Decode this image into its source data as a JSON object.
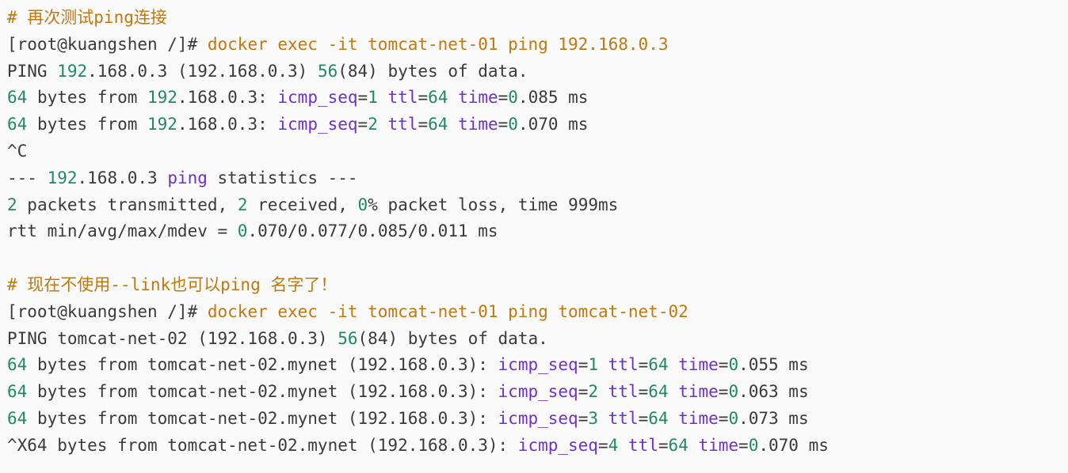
{
  "theme": {
    "background": "#fafafa",
    "text": "#3a3a3a",
    "number": "#1f8a5f",
    "keyword": "#6f2fd1",
    "command": "#c0780f",
    "comment": "#c0780f"
  },
  "terminal_lines": [
    [
      {
        "t": "comment",
        "v": "# 再次测试ping连接"
      }
    ],
    [
      {
        "t": "prompt",
        "v": "[root@kuangshen /]# "
      },
      {
        "t": "command",
        "v": "docker exec -it tomcat-net-01 ping 192.168.0.3"
      }
    ],
    [
      {
        "t": "text",
        "v": "PING "
      },
      {
        "t": "number",
        "v": "192"
      },
      {
        "t": "text",
        "v": ".168.0.3 (192.168.0.3) "
      },
      {
        "t": "number",
        "v": "56"
      },
      {
        "t": "text",
        "v": "(84) bytes of data."
      }
    ],
    [
      {
        "t": "number",
        "v": "64"
      },
      {
        "t": "text",
        "v": " bytes from "
      },
      {
        "t": "number",
        "v": "192"
      },
      {
        "t": "text",
        "v": ".168.0.3: "
      },
      {
        "t": "keyword",
        "v": "icmp_seq"
      },
      {
        "t": "text",
        "v": "="
      },
      {
        "t": "number",
        "v": "1"
      },
      {
        "t": "text",
        "v": " "
      },
      {
        "t": "keyword",
        "v": "ttl"
      },
      {
        "t": "text",
        "v": "="
      },
      {
        "t": "number",
        "v": "64"
      },
      {
        "t": "text",
        "v": " "
      },
      {
        "t": "keyword",
        "v": "time"
      },
      {
        "t": "text",
        "v": "="
      },
      {
        "t": "number",
        "v": "0"
      },
      {
        "t": "text",
        "v": ".085 ms"
      }
    ],
    [
      {
        "t": "number",
        "v": "64"
      },
      {
        "t": "text",
        "v": " bytes from "
      },
      {
        "t": "number",
        "v": "192"
      },
      {
        "t": "text",
        "v": ".168.0.3: "
      },
      {
        "t": "keyword",
        "v": "icmp_seq"
      },
      {
        "t": "text",
        "v": "="
      },
      {
        "t": "number",
        "v": "2"
      },
      {
        "t": "text",
        "v": " "
      },
      {
        "t": "keyword",
        "v": "ttl"
      },
      {
        "t": "text",
        "v": "="
      },
      {
        "t": "number",
        "v": "64"
      },
      {
        "t": "text",
        "v": " "
      },
      {
        "t": "keyword",
        "v": "time"
      },
      {
        "t": "text",
        "v": "="
      },
      {
        "t": "number",
        "v": "0"
      },
      {
        "t": "text",
        "v": ".070 ms"
      }
    ],
    [
      {
        "t": "text",
        "v": "^C"
      }
    ],
    [
      {
        "t": "text",
        "v": "--- "
      },
      {
        "t": "number",
        "v": "192"
      },
      {
        "t": "text",
        "v": ".168.0.3 "
      },
      {
        "t": "keyword",
        "v": "ping"
      },
      {
        "t": "text",
        "v": " statistics ---"
      }
    ],
    [
      {
        "t": "number",
        "v": "2"
      },
      {
        "t": "text",
        "v": " packets transmitted, "
      },
      {
        "t": "number",
        "v": "2"
      },
      {
        "t": "text",
        "v": " received, "
      },
      {
        "t": "number",
        "v": "0"
      },
      {
        "t": "text",
        "v": "% packet loss, time 999ms"
      }
    ],
    [
      {
        "t": "text",
        "v": "rtt min/avg/max/mdev = "
      },
      {
        "t": "number",
        "v": "0"
      },
      {
        "t": "text",
        "v": ".070/0.077/0.085/0.011 ms"
      }
    ],
    [],
    [
      {
        "t": "comment",
        "v": "# 现在不使用--link也可以ping 名字了！"
      }
    ],
    [
      {
        "t": "prompt",
        "v": "[root@kuangshen /]# "
      },
      {
        "t": "command",
        "v": "docker exec -it tomcat-net-01 ping tomcat-net-02"
      }
    ],
    [
      {
        "t": "text",
        "v": "PING tomcat-net-02 (192.168.0.3) "
      },
      {
        "t": "number",
        "v": "56"
      },
      {
        "t": "text",
        "v": "(84) bytes of data."
      }
    ],
    [
      {
        "t": "number",
        "v": "64"
      },
      {
        "t": "text",
        "v": " bytes from tomcat-net-02.mynet (192.168.0.3): "
      },
      {
        "t": "keyword",
        "v": "icmp_seq"
      },
      {
        "t": "text",
        "v": "="
      },
      {
        "t": "number",
        "v": "1"
      },
      {
        "t": "text",
        "v": " "
      },
      {
        "t": "keyword",
        "v": "ttl"
      },
      {
        "t": "text",
        "v": "="
      },
      {
        "t": "number",
        "v": "64"
      },
      {
        "t": "text",
        "v": " "
      },
      {
        "t": "keyword",
        "v": "time"
      },
      {
        "t": "text",
        "v": "="
      },
      {
        "t": "number",
        "v": "0"
      },
      {
        "t": "text",
        "v": ".055 ms"
      }
    ],
    [
      {
        "t": "number",
        "v": "64"
      },
      {
        "t": "text",
        "v": " bytes from tomcat-net-02.mynet (192.168.0.3): "
      },
      {
        "t": "keyword",
        "v": "icmp_seq"
      },
      {
        "t": "text",
        "v": "="
      },
      {
        "t": "number",
        "v": "2"
      },
      {
        "t": "text",
        "v": " "
      },
      {
        "t": "keyword",
        "v": "ttl"
      },
      {
        "t": "text",
        "v": "="
      },
      {
        "t": "number",
        "v": "64"
      },
      {
        "t": "text",
        "v": " "
      },
      {
        "t": "keyword",
        "v": "time"
      },
      {
        "t": "text",
        "v": "="
      },
      {
        "t": "number",
        "v": "0"
      },
      {
        "t": "text",
        "v": ".063 ms"
      }
    ],
    [
      {
        "t": "number",
        "v": "64"
      },
      {
        "t": "text",
        "v": " bytes from tomcat-net-02.mynet (192.168.0.3): "
      },
      {
        "t": "keyword",
        "v": "icmp_seq"
      },
      {
        "t": "text",
        "v": "="
      },
      {
        "t": "number",
        "v": "3"
      },
      {
        "t": "text",
        "v": " "
      },
      {
        "t": "keyword",
        "v": "ttl"
      },
      {
        "t": "text",
        "v": "="
      },
      {
        "t": "number",
        "v": "64"
      },
      {
        "t": "text",
        "v": " "
      },
      {
        "t": "keyword",
        "v": "time"
      },
      {
        "t": "text",
        "v": "="
      },
      {
        "t": "number",
        "v": "0"
      },
      {
        "t": "text",
        "v": ".073 ms"
      }
    ],
    [
      {
        "t": "text",
        "v": "^X64 bytes from tomcat-net-02.mynet (192.168.0.3): "
      },
      {
        "t": "keyword",
        "v": "icmp_seq"
      },
      {
        "t": "text",
        "v": "="
      },
      {
        "t": "number",
        "v": "4"
      },
      {
        "t": "text",
        "v": " "
      },
      {
        "t": "keyword",
        "v": "ttl"
      },
      {
        "t": "text",
        "v": "="
      },
      {
        "t": "number",
        "v": "64"
      },
      {
        "t": "text",
        "v": " "
      },
      {
        "t": "keyword",
        "v": "time"
      },
      {
        "t": "text",
        "v": "="
      },
      {
        "t": "number",
        "v": "0"
      },
      {
        "t": "text",
        "v": ".070 ms"
      }
    ]
  ]
}
